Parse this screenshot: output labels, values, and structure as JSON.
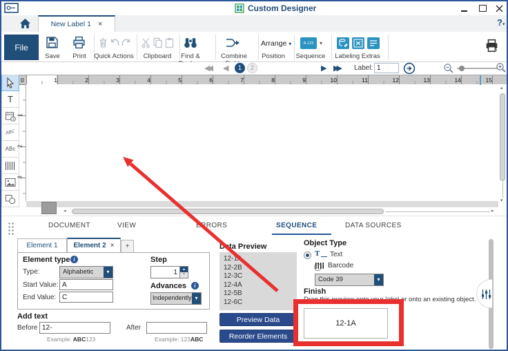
{
  "window": {
    "title": "Custom Designer",
    "help": "?"
  },
  "doc_tab": {
    "label": "New Label 1"
  },
  "ribbon": {
    "file": "File",
    "save": "Save",
    "print": "Print",
    "quick_actions": "Quick Actions",
    "clipboard": "Clipboard",
    "find_replace": "Find & Replace",
    "combine_fields": "Combine Fields",
    "arrange": "Arrange",
    "position": "Position",
    "sequence": "Sequence",
    "sequence_icon_text": "A-123",
    "labeling_extras": "Labeling Extras"
  },
  "nav": {
    "label": "Label:",
    "value": "1",
    "page1": "1",
    "page2": "2"
  },
  "ruler": {
    "origin": "0",
    "h_marks": [
      "1",
      "2",
      "3",
      "4",
      "5",
      "6",
      "7",
      "8",
      "9",
      "10",
      "11",
      "12",
      "13",
      "14",
      "15"
    ],
    "v_marks": [
      "1",
      "2",
      "3"
    ]
  },
  "tools": {
    "text": "T",
    "curved": "ABC",
    "abc": "ABc"
  },
  "panel": {
    "tabs": [
      "DOCUMENT",
      "VIEW",
      "ERRORS",
      "SEQUENCE",
      "DATA SOURCES"
    ],
    "element_tabs": {
      "tab1": "Element 1",
      "tab2": "Element 2",
      "add": "+"
    },
    "element_type": {
      "heading": "Element type",
      "type_label": "Type:",
      "type_value": "Alphabetic",
      "start_label": "Start Value:",
      "start_value": "A",
      "end_label": "End Value:",
      "end_value": "C"
    },
    "step": {
      "heading": "Step",
      "value": "1"
    },
    "advances": {
      "heading": "Advances",
      "value": "Independently"
    },
    "add_text": {
      "heading": "Add text",
      "before_label": "Before",
      "before_value": "12-",
      "after_label": "After",
      "after_value": "",
      "before_example": {
        "prefix": "Example: ",
        "bold": "ABC",
        "rest": "123"
      },
      "after_example": {
        "prefix": "Example: ",
        "rest": "123",
        "bold": "ABC"
      }
    },
    "data_preview": {
      "heading": "Data Preview",
      "items": [
        "12-1A",
        "12-2B",
        "12-3C",
        "12-4A",
        "12-5B",
        "12-6C"
      ],
      "preview_button": "Preview Data",
      "reorder_button": "Reorder Elements"
    },
    "object_type": {
      "heading": "Object Type",
      "text_label": "Text",
      "barcode_label": "Barcode",
      "barcode_type": "Code 39"
    },
    "finish": {
      "heading": "Finish",
      "instruction": "Drag this preview onto your label or onto an existing object.",
      "preview_value": "12-1A"
    }
  },
  "icons": {
    "caret_down": "▾",
    "close": "×",
    "back_double": "◀◀",
    "back": "◀",
    "forward": "▶",
    "forward_double": "▶▶",
    "up_small": "▴",
    "down_small": "▾",
    "left_small": "◂",
    "right_small": "▸",
    "info": "i"
  },
  "colors": {
    "accent": "#1f4e79",
    "ribbon_blue": "#2b93c0",
    "annotation_red": "#e8312f",
    "button_blue": "#2a4a8c"
  }
}
